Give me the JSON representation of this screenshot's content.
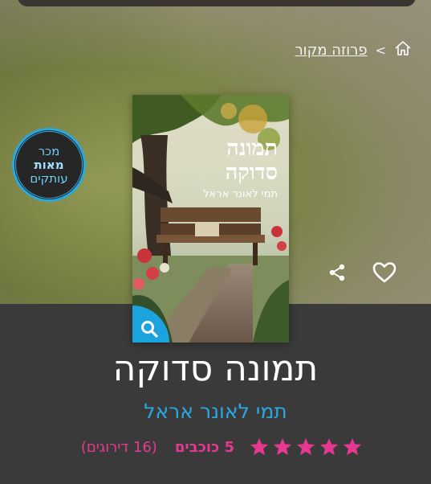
{
  "breadcrumb": {
    "home_icon": "home-icon",
    "separator": ">",
    "category": "פרוזה מקור"
  },
  "badge": {
    "line1": "מכר",
    "line2": "מאות",
    "line3": "עותקים"
  },
  "cover": {
    "title_line1": "תמונה",
    "title_line2": "סדוקה",
    "author": "תמי לאונר אראל"
  },
  "actions": {
    "share_icon": "share-icon",
    "favorite_icon": "heart-icon",
    "zoom_icon": "search-icon"
  },
  "book": {
    "title": "תמונה סדוקה",
    "author": "תמי לאונר אראל"
  },
  "rating": {
    "stars": 5,
    "stars_label": "5 כוכבים",
    "count_label": "(16 דירוגים)",
    "star_color": "#e5388f"
  },
  "colors": {
    "accent_blue": "#29a9e0",
    "pink": "#e5388f",
    "panel": "#3a3a3a"
  }
}
